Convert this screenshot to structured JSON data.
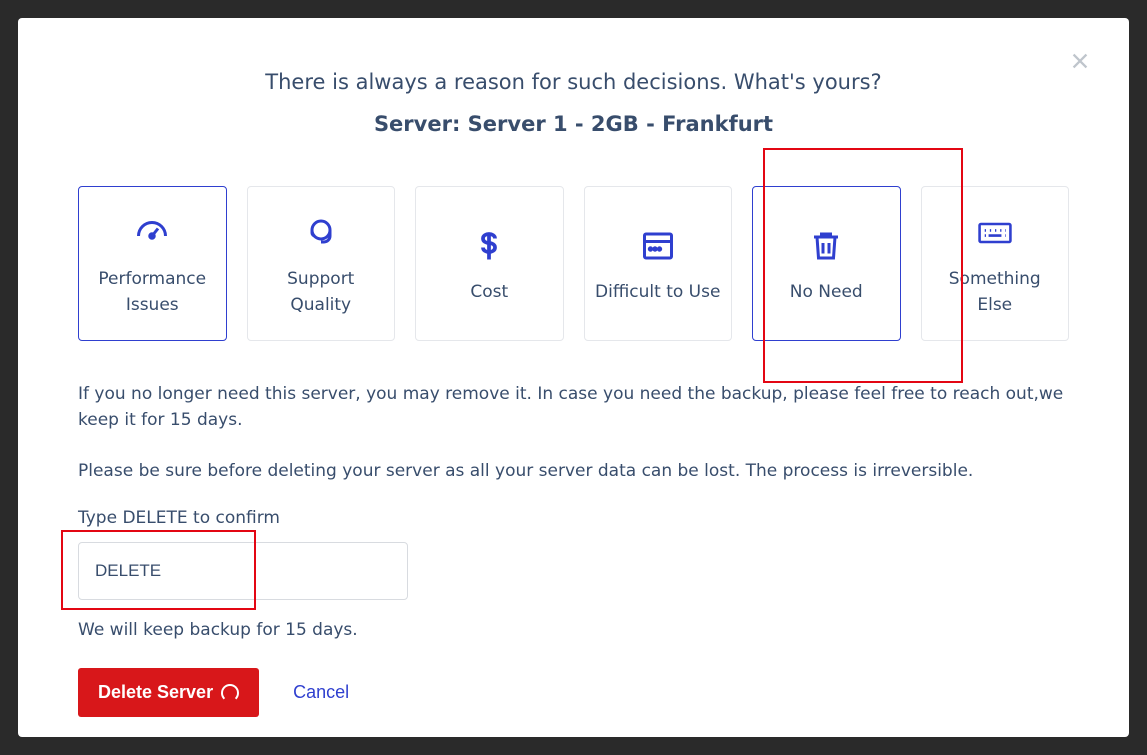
{
  "title": "There is always a reason for such decisions. What's yours?",
  "subtitle": "Server: Server 1 - 2GB - Frankfurt",
  "reasons": [
    {
      "label": "Performance Issues",
      "icon": "gauge-icon",
      "selected": true
    },
    {
      "label": "Support Quality",
      "icon": "support-icon",
      "selected": false
    },
    {
      "label": "Cost",
      "icon": "dollar-icon",
      "selected": false
    },
    {
      "label": "Difficult to Use",
      "icon": "window-icon",
      "selected": false
    },
    {
      "label": "No Need",
      "icon": "trash-icon",
      "selected": true
    },
    {
      "label": "Something Else",
      "icon": "keyboard-icon",
      "selected": false
    }
  ],
  "body": {
    "p1": "If you no longer need this server, you may remove it. In case you need the backup, please feel free to reach out,we keep it for 15 days.",
    "p2": "Please be sure before deleting your server as all your server data can be lost. The process is irreversible."
  },
  "confirm": {
    "label": "Type DELETE to confirm",
    "value": "DELETE"
  },
  "backup_note": "We will keep backup for 15 days.",
  "actions": {
    "delete": "Delete Server",
    "cancel": "Cancel"
  }
}
